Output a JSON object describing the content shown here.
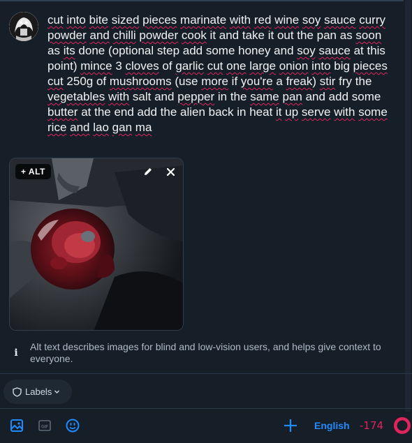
{
  "post": {
    "text_segments": [
      {
        "t": "cut",
        "s": true
      },
      {
        "t": " "
      },
      {
        "t": "into",
        "s": true
      },
      {
        "t": " "
      },
      {
        "t": "bite",
        "s": true
      },
      {
        "t": " "
      },
      {
        "t": "sized",
        "s": true
      },
      {
        "t": " "
      },
      {
        "t": "pieces",
        "s": true
      },
      {
        "t": " "
      },
      {
        "t": "marinate",
        "s": true
      },
      {
        "t": " "
      },
      {
        "t": "with",
        "s": true
      },
      {
        "t": " "
      },
      {
        "t": "red",
        "s": true
      },
      {
        "t": " "
      },
      {
        "t": "wine",
        "s": true
      },
      {
        "t": " "
      },
      {
        "t": "soy",
        "s": true
      },
      {
        "t": " "
      },
      {
        "t": "sauce",
        "s": true
      },
      {
        "t": " "
      },
      {
        "t": "curry",
        "s": true
      },
      {
        "t": " "
      },
      {
        "t": "powder",
        "s": true
      },
      {
        "t": " "
      },
      {
        "t": "and",
        "s": true
      },
      {
        "t": " "
      },
      {
        "t": "chilli",
        "s": true
      },
      {
        "t": " "
      },
      {
        "t": "powder",
        "s": true
      },
      {
        "t": " "
      },
      {
        "t": "cook",
        "s": true
      },
      {
        "t": " it and take it out the pan as "
      },
      {
        "t": "soon",
        "s": true
      },
      {
        "t": " as "
      },
      {
        "t": "its",
        "s": true
      },
      {
        "t": " done (optional step add some honey and "
      },
      {
        "t": "soy",
        "s": true
      },
      {
        "t": " "
      },
      {
        "t": "sauce",
        "s": true
      },
      {
        "t": " at this point) "
      },
      {
        "t": "mince",
        "s": true
      },
      {
        "t": " 3 "
      },
      {
        "t": "cloves",
        "s": true
      },
      {
        "t": " of "
      },
      {
        "t": "garlic",
        "s": true
      },
      {
        "t": " "
      },
      {
        "t": "cut",
        "s": true
      },
      {
        "t": " "
      },
      {
        "t": "one",
        "s": true
      },
      {
        "t": " "
      },
      {
        "t": "large",
        "s": true
      },
      {
        "t": " "
      },
      {
        "t": "onion",
        "s": true
      },
      {
        "t": " "
      },
      {
        "t": "into",
        "s": true
      },
      {
        "t": " big "
      },
      {
        "t": "pieces",
        "s": true
      },
      {
        "t": " "
      },
      {
        "t": "cut",
        "s": true
      },
      {
        "t": " 250g of "
      },
      {
        "t": "mushrooms",
        "s": true
      },
      {
        "t": " (use "
      },
      {
        "t": "more",
        "s": true
      },
      {
        "t": " if "
      },
      {
        "t": "you're",
        "s": true
      },
      {
        "t": " a "
      },
      {
        "t": "freak",
        "s": true
      },
      {
        "t": ") "
      },
      {
        "t": "stir",
        "s": true
      },
      {
        "t": " fry the "
      },
      {
        "t": "vegetables",
        "s": true
      },
      {
        "t": " "
      },
      {
        "t": "with",
        "s": true
      },
      {
        "t": " salt and "
      },
      {
        "t": "pepper",
        "s": true
      },
      {
        "t": " in the "
      },
      {
        "t": "same",
        "s": true
      },
      {
        "t": " "
      },
      {
        "t": "pan",
        "s": true
      },
      {
        "t": " and add some "
      },
      {
        "t": "butter",
        "s": true
      },
      {
        "t": " at the end add the alien back in heat "
      },
      {
        "t": "it",
        "s": true
      },
      {
        "t": " "
      },
      {
        "t": "up",
        "s": true
      },
      {
        "t": " "
      },
      {
        "t": "serve",
        "s": true
      },
      {
        "t": " "
      },
      {
        "t": "with",
        "s": true
      },
      {
        "t": " "
      },
      {
        "t": "some",
        "s": true
      },
      {
        "t": " "
      },
      {
        "t": "rice",
        "s": true
      },
      {
        "t": " "
      },
      {
        "t": "and",
        "s": true
      },
      {
        "t": " "
      },
      {
        "t": "lao",
        "s": true
      },
      {
        "t": " "
      },
      {
        "t": "gan",
        "s": true
      },
      {
        "t": " "
      },
      {
        "t": "ma",
        "s": true
      }
    ]
  },
  "image": {
    "alt_button_label": "+ ALT"
  },
  "alt_info": {
    "text": "Alt text describes images for blind and low-vision users, and helps give context to everyone."
  },
  "labels_button": {
    "label": "Labels"
  },
  "toolbar": {
    "language": "English",
    "char_count": "-174"
  },
  "colors": {
    "accent": "#208bfe",
    "danger": "#e0245e",
    "background": "#161e27"
  },
  "icons": [
    "avatar",
    "edit-icon",
    "close-icon",
    "info-icon",
    "shield-icon",
    "chevron-down-icon",
    "image-icon",
    "gif-icon",
    "emoji-icon",
    "plus-icon",
    "progress-ring"
  ]
}
